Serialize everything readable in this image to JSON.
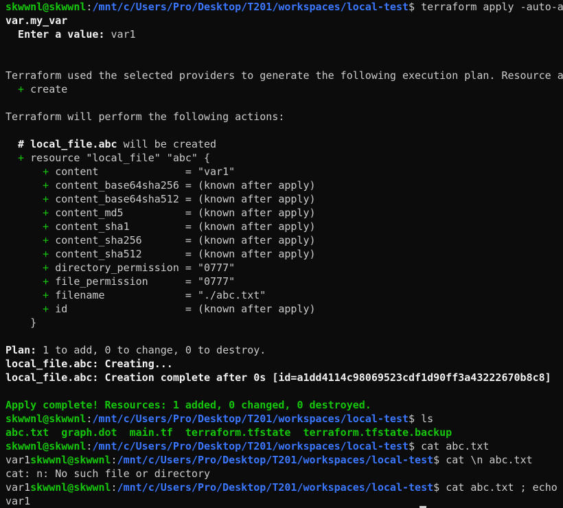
{
  "terminal": {
    "user_host": "skwwnl@skwwnl",
    "colon": ":",
    "cwd": "/mnt/c/Users/Pro/Desktop/T201/workspaces/local-test",
    "prompt_char": "$ ",
    "lines": {
      "l1_cmd": "terraform apply -auto-ap",
      "l2": "var.my_var",
      "l3_label": "  Enter a value:",
      "l3_value": " var1",
      "l6": "Terraform used the selected providers to generate the following execution plan. Resource ac",
      "l7_plus": "  +",
      "l7_text": " create",
      "l9": "Terraform will perform the following actions:",
      "l11_bold": "  # local_file.abc",
      "l11_text": " will be created",
      "l12_plus": "  +",
      "l12_text": " resource \"local_file\" \"abc\" {",
      "attrs": [
        {
          "plus": "      +",
          "text": " content              = \"var1\""
        },
        {
          "plus": "      +",
          "text": " content_base64sha256 = (known after apply)"
        },
        {
          "plus": "      +",
          "text": " content_base64sha512 = (known after apply)"
        },
        {
          "plus": "      +",
          "text": " content_md5          = (known after apply)"
        },
        {
          "plus": "      +",
          "text": " content_sha1         = (known after apply)"
        },
        {
          "plus": "      +",
          "text": " content_sha256       = (known after apply)"
        },
        {
          "plus": "      +",
          "text": " content_sha512       = (known after apply)"
        },
        {
          "plus": "      +",
          "text": " directory_permission = \"0777\""
        },
        {
          "plus": "      +",
          "text": " file_permission      = \"0777\""
        },
        {
          "plus": "      +",
          "text": " filename             = \"./abc.txt\""
        },
        {
          "plus": "      +",
          "text": " id                   = (known after apply)"
        }
      ],
      "l24": "    }",
      "l26_bold": "Plan:",
      "l26_text": " 1 to add, 0 to change, 0 to destroy.",
      "l27_bold": "local_file.abc: Creating...",
      "l28_bold": "local_file.abc: Creation complete after 0s [id=a1dd4114c98069523cdf1d90ff3a43222670b8c8]",
      "l30": "Apply complete! Resources: 1 added, 0 changed, 0 destroyed.",
      "l31_cmd": "ls",
      "l32": "abc.txt  graph.dot  main.tf  terraform.tfstate  terraform.tfstate.backup",
      "l33_cmd": "cat abc.txt",
      "l34_prefix": "var1",
      "l34_cmd": "cat \\n abc.txt",
      "l35": "cat: n: No such file or directory",
      "l36_prefix": "var1",
      "l36_cmd": "cat abc.txt ; echo",
      "l37": "var1"
    }
  }
}
